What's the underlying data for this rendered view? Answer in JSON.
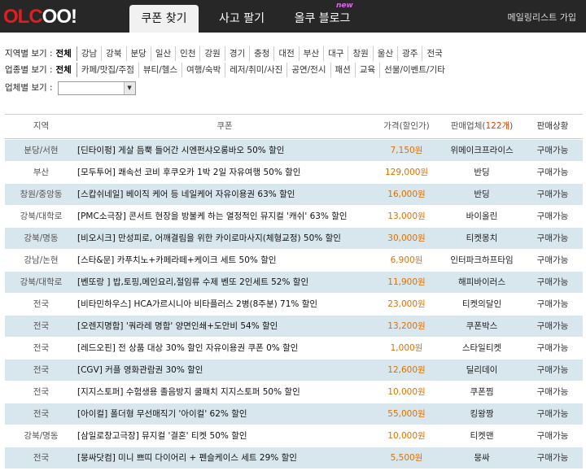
{
  "header": {
    "logo_part1": "OLC",
    "logo_part2": "OO!",
    "tabs": [
      {
        "label": "쿠폰 찾기"
      },
      {
        "label": "사고 팔기"
      },
      {
        "label": "올쿠 블로그"
      }
    ],
    "new_badge": "new",
    "mailing_link": "메일링리스트 가입"
  },
  "filters": {
    "region": {
      "label": "지역별 보기 :",
      "all": "전체",
      "items": [
        "강남",
        "강북",
        "분당",
        "일산",
        "인천",
        "강원",
        "경기",
        "충청",
        "대전",
        "부산",
        "대구",
        "창원",
        "울산",
        "광주",
        "전국"
      ]
    },
    "category": {
      "label": "업종별 보기 :",
      "all": "전체",
      "items": [
        "카페/맛집/주점",
        "뷰티/헬스",
        "여행/숙박",
        "레저/취미/사진",
        "공연/전시",
        "패션",
        "교육",
        "선물/이벤트/기타"
      ]
    },
    "company": {
      "label": "업체별 보기 :",
      "selected": ""
    }
  },
  "table": {
    "headers": {
      "region": "지역",
      "coupon": "쿠폰",
      "price": "가격(할인가)",
      "seller_prefix": "판매업체(",
      "seller_count": "122개",
      "seller_suffix": ")",
      "status": "판매상황"
    },
    "rows": [
      {
        "region": "분당/서현",
        "coupon": "[딘타이펑] 게살 듬뿍 들어간 시엔펀샤오롱바오 50% 할인",
        "price": "7,150원",
        "seller": "위메이크프라이스",
        "status": "구매가능"
      },
      {
        "region": "부산",
        "coupon": "[모두투어] 쾌속선 코비 후쿠오카 1박 2일 자유여행 50% 할인",
        "price": "129,000원",
        "seller": "반딩",
        "status": "구매가능"
      },
      {
        "region": "창원/중앙동",
        "coupon": "[스캅쉬네일] 베이직 케어 등 네일케어 자유이용권 63% 할인",
        "price": "16,000원",
        "seller": "반딩",
        "status": "구매가능"
      },
      {
        "region": "강북/대학로",
        "coupon": "[PMC소극장] 콘서트 현장을 방불케 하는 열정적인 뮤지컬 '캐쉬' 63% 할인",
        "price": "13,000원",
        "seller": "바이올린",
        "status": "구매가능"
      },
      {
        "region": "강북/명동",
        "coupon": "[비오시크] 만성피로, 어깨결림을 위한 카이로마사지(체형교정) 50% 할인",
        "price": "30,000원",
        "seller": "티켓몽치",
        "status": "구매가능"
      },
      {
        "region": "강남/논현",
        "coupon": "[스타&문] 카푸치노+카페라떼+케이크 세트 50% 할인",
        "price": "6,900원",
        "seller": "인터파크하프타임",
        "status": "구매가능"
      },
      {
        "region": "강북/대학로",
        "coupon": "[벤또랑 ] 밥,토핑,메인요리,절임류 수제 벤또 2인세트 52% 할인",
        "price": "11,900원",
        "seller": "해피바이러스",
        "status": "구매가능"
      },
      {
        "region": "전국",
        "coupon": "[비타민하우스] HCA가르시니아 비타플러스 2병(8주분) 71% 할인",
        "price": "23,000원",
        "seller": "티켓의달인",
        "status": "구매가능"
      },
      {
        "region": "전국",
        "coupon": "[오렌지명함] '쿼라레 명함' 양면인쇄+도안비 54% 할인",
        "price": "13,200원",
        "seller": "쿠폰박스",
        "status": "구매가능"
      },
      {
        "region": "전국",
        "coupon": "[레드오핀] 전 상품 대상 30% 할인 자유이용권 쿠폰 0% 할인",
        "price": "1,000원",
        "seller": "스타일티켓",
        "status": "구매가능"
      },
      {
        "region": "전국",
        "coupon": "[CGV] 커플 영화관람권 30% 할인",
        "price": "12,600원",
        "seller": "딜리데이",
        "status": "구매가능"
      },
      {
        "region": "전국",
        "coupon": "[지지스토퍼] 수험생용 졸음방지 쿨패치 지지스토퍼 50% 할인",
        "price": "10,000원",
        "seller": "쿠폰찜",
        "status": "구매가능"
      },
      {
        "region": "전국",
        "coupon": "[아이컬] 폴더형 무선매직기 '아이컬' 62% 할인",
        "price": "55,000원",
        "seller": "킹왕짱",
        "status": "구매가능"
      },
      {
        "region": "강북/명동",
        "coupon": "[삼일로창고극장] 뮤지컬 '결혼' 티켓 50% 할인",
        "price": "10,000원",
        "seller": "티켓맨",
        "status": "구매가능"
      },
      {
        "region": "전국",
        "coupon": "[뭉싸닷컴] 미니 쁘띠 다이어리 + 펜슬케이스 세트 29% 할인",
        "price": "5,500원",
        "seller": "뭉싸",
        "status": "구매가능"
      }
    ]
  },
  "colors": {
    "header_bg": "#272727",
    "logo_red": "#e31d1d",
    "row_alt": "#d8e6ee",
    "price": "#e07000",
    "new_badge": "#d86ae6"
  }
}
